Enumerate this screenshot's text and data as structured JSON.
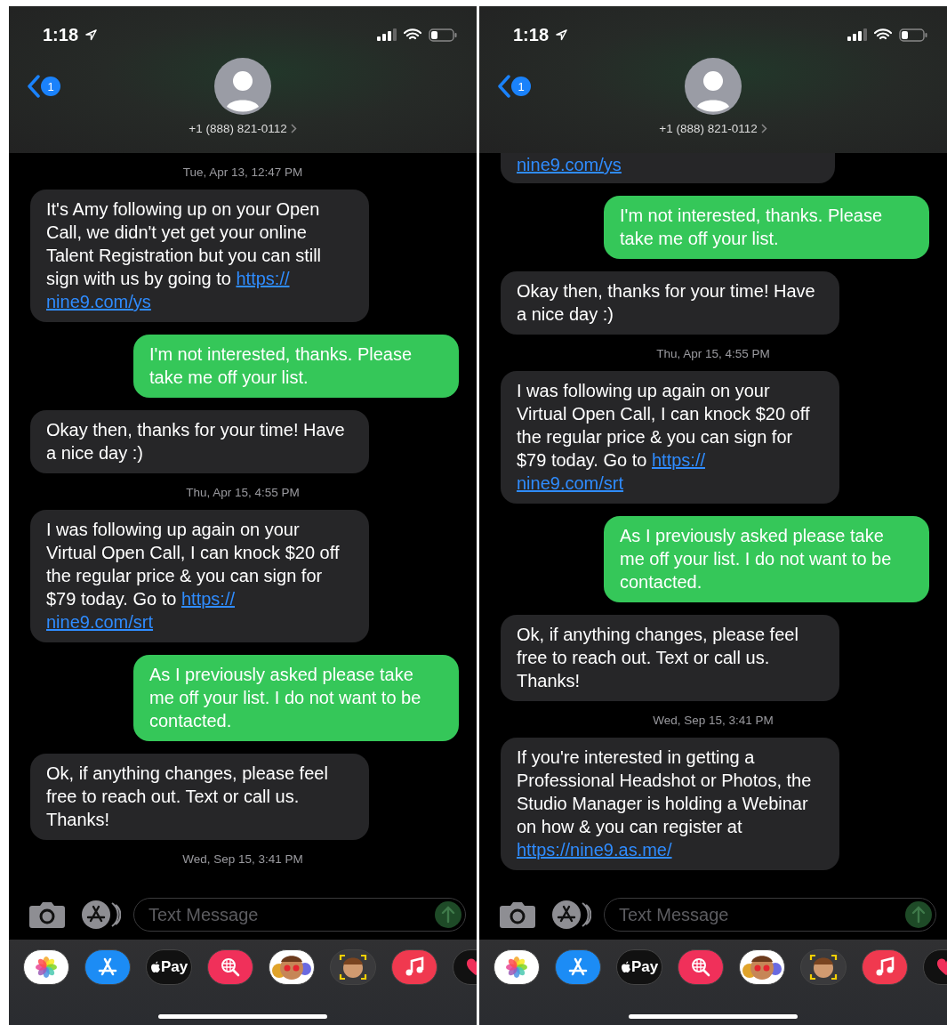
{
  "phones": [
    {
      "status_bar": {
        "time": "1:18"
      },
      "header": {
        "badge": "1",
        "contact": "+1 (888) 821-0112"
      },
      "messages": [
        {
          "kind": "timestamp",
          "text": "Tue, Apr 13, 12:47 PM"
        },
        {
          "kind": "incoming",
          "text": "It's Amy following up on your Open Call, we didn't yet get your online Talent Registration but you can still sign with us by going to",
          "link": [
            "https://",
            "nine9.com/ys"
          ]
        },
        {
          "kind": "outgoing",
          "text": "I'm not interested, thanks. Please take me off your list."
        },
        {
          "kind": "incoming",
          "text": "Okay then, thanks for your time! Have a nice day :)"
        },
        {
          "kind": "timestamp",
          "text": "Thu, Apr 15, 4:55 PM"
        },
        {
          "kind": "incoming",
          "text": "I was following up again on your Virtual Open Call, I can knock $20 off the regular price & you can sign for $79 today. Go to",
          "link": [
            "https://",
            "nine9.com/srt"
          ]
        },
        {
          "kind": "outgoing",
          "text": "As I previously asked please take me off your list. I do not want to be contacted."
        },
        {
          "kind": "incoming",
          "text": "Ok, if anything changes, please feel free to reach out. Text or call us. Thanks!"
        },
        {
          "kind": "timestamp",
          "text": "Wed, Sep 15, 3:41 PM"
        }
      ],
      "composer": {
        "placeholder": "Text Message"
      },
      "apps": [
        {
          "kind": "photos"
        },
        {
          "kind": "appstore"
        },
        {
          "kind": "applepay",
          "label": "Pay"
        },
        {
          "kind": "websearch"
        },
        {
          "kind": "memoji"
        },
        {
          "kind": "memojicam"
        },
        {
          "kind": "music"
        },
        {
          "kind": "heart"
        }
      ]
    },
    {
      "status_bar": {
        "time": "1:18"
      },
      "header": {
        "badge": "1",
        "contact": "+1 (888) 821-0112"
      },
      "messages": [
        {
          "kind": "incoming",
          "link": [
            "nine9.com/ys"
          ]
        },
        {
          "kind": "outgoing",
          "text": "I'm not interested, thanks. Please take me off your list."
        },
        {
          "kind": "incoming",
          "text": "Okay then, thanks for your time! Have a nice day :)"
        },
        {
          "kind": "timestamp",
          "text": "Thu, Apr 15, 4:55 PM"
        },
        {
          "kind": "incoming",
          "text": "I was following up again on your Virtual Open Call, I can knock $20 off the regular price & you can sign for $79 today. Go to",
          "link": [
            "https://",
            "nine9.com/srt"
          ]
        },
        {
          "kind": "outgoing",
          "text": "As I previously asked please take me off your list. I do not want to be contacted."
        },
        {
          "kind": "incoming",
          "text": "Ok, if anything changes, please feel free to reach out. Text or call us. Thanks!"
        },
        {
          "kind": "timestamp",
          "text": "Wed, Sep 15, 3:41 PM"
        },
        {
          "kind": "incoming",
          "text": "If you're interested in getting a Professional Headshot or Photos, the Studio Manager is holding a Webinar on how & you can register at",
          "link": [
            "https://nine9.as.me/"
          ]
        }
      ],
      "composer": {
        "placeholder": "Text Message"
      },
      "apps": [
        {
          "kind": "photos"
        },
        {
          "kind": "appstore"
        },
        {
          "kind": "applepay",
          "label": "Pay"
        },
        {
          "kind": "websearch"
        },
        {
          "kind": "memoji"
        },
        {
          "kind": "memojicam"
        },
        {
          "kind": "music"
        },
        {
          "kind": "heart"
        }
      ]
    }
  ]
}
